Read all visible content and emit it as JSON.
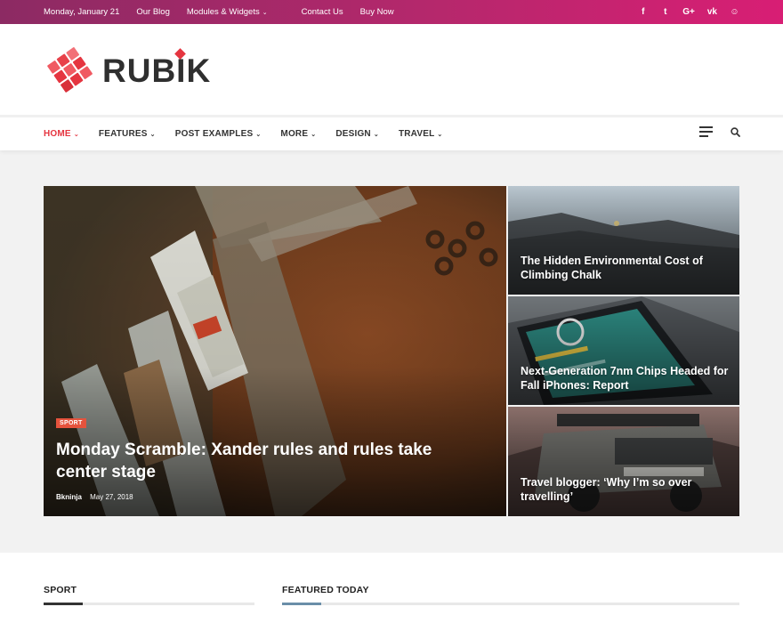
{
  "topbar": {
    "date": "Monday, January 21",
    "links": [
      "Our Blog",
      "Modules & Widgets",
      "Contact Us",
      "Buy Now"
    ],
    "social_icons": [
      {
        "icon": "facebook-icon",
        "glyph": "f"
      },
      {
        "icon": "twitter-icon",
        "glyph": "t"
      },
      {
        "icon": "google-plus-icon",
        "glyph": "G+"
      },
      {
        "icon": "vk-icon",
        "glyph": "vk"
      },
      {
        "icon": "snapchat-icon",
        "glyph": "☺"
      }
    ]
  },
  "logo": {
    "text": "RUBIK"
  },
  "nav": {
    "items": [
      "HOME",
      "FEATURES",
      "POST EXAMPLES",
      "MORE",
      "DESIGN",
      "TRAVEL"
    ]
  },
  "featured": {
    "main": {
      "category": "SPORT",
      "title": "Monday Scramble: Xander rules and rules take center stage",
      "author": "Bkninja",
      "date": "May 27, 2018"
    },
    "side": [
      {
        "title": "The Hidden Environmental Cost of Climbing Chalk"
      },
      {
        "title": "Next-Generation 7nm Chips Headed for Fall iPhones: Report"
      },
      {
        "title": "Travel blogger: ‘Why I’m so over travelling’"
      }
    ]
  },
  "sections": {
    "sport": "SPORT",
    "featured_today": "FEATURED TODAY"
  },
  "colors": {
    "accent": "#e53540",
    "topbar_start": "#8c2a63",
    "topbar_end": "#d81e74"
  }
}
